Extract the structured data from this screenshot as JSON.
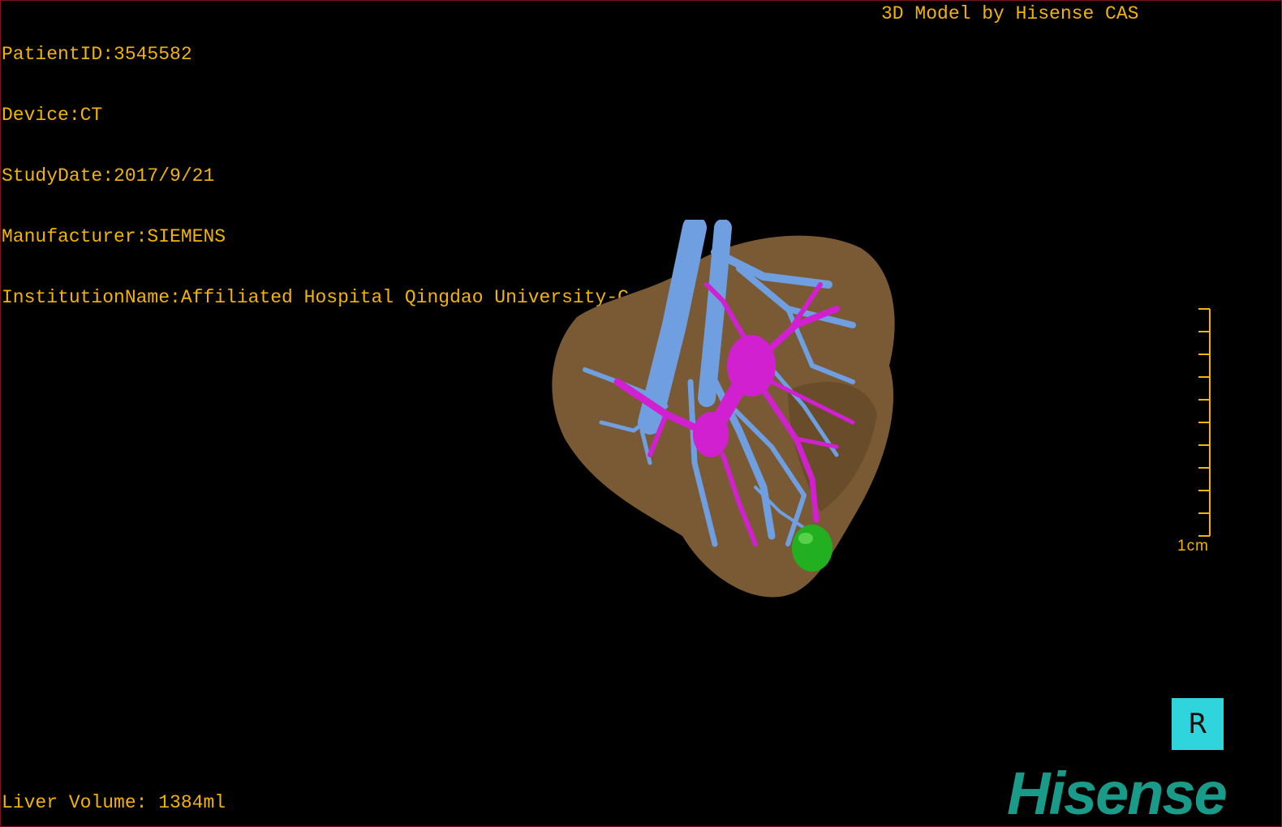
{
  "overlay": {
    "patient_id": "PatientID:3545582",
    "device": "Device:CT",
    "study_date": "StudyDate:2017/9/21",
    "manufacturer": "Manufacturer:SIEMENS",
    "institution": "InstitutionName:Affiliated Hospital Qingdao University-C",
    "vendor": "3D Model by Hisense CAS",
    "liver_volume": "Liver Volume: 1384ml"
  },
  "scale_bar": {
    "label": "1cm"
  },
  "orientation_marker": {
    "label": "R"
  },
  "brand": {
    "logo_text": "Hisense"
  },
  "colors": {
    "overlay_text": "#f2b400",
    "liver": "#7a5a34",
    "hepatic_vein": "#6f9fe0",
    "portal_vein": "#d020d0",
    "lesion": "#22b020",
    "orientation_box": "#30d4dc",
    "logo": "#1a9b8a",
    "viewport_border": "#7a1420"
  }
}
